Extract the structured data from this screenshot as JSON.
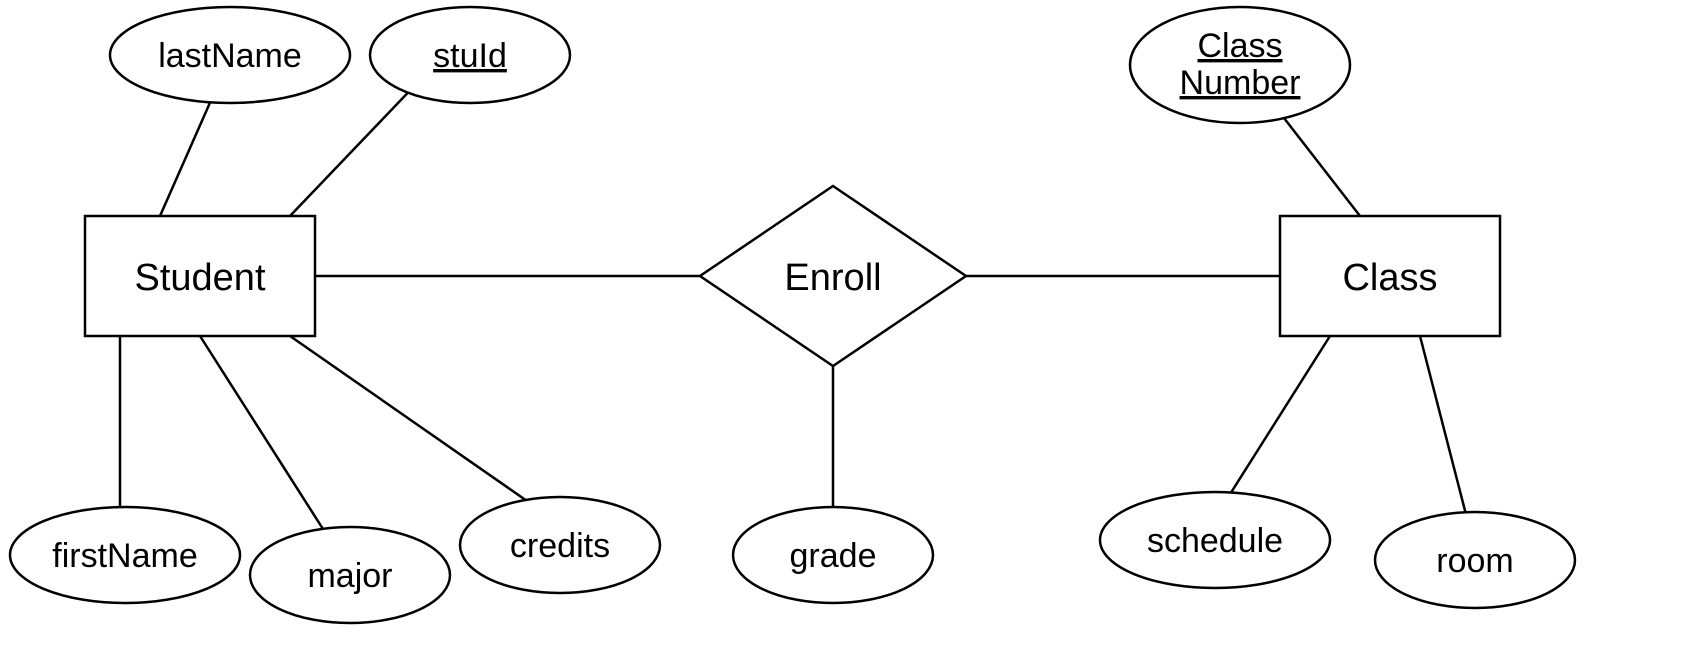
{
  "entities": {
    "student": {
      "label": "Student",
      "attributes": {
        "lastName": "lastName",
        "stuId": "stuId",
        "firstName": "firstName",
        "major": "major",
        "credits": "credits"
      }
    },
    "class": {
      "label": "Class",
      "attributes": {
        "classNumber_line1": "Class",
        "classNumber_line2": "Number",
        "schedule": "schedule",
        "room": "room"
      }
    }
  },
  "relationships": {
    "enroll": {
      "label": "Enroll",
      "attributes": {
        "grade": "grade"
      }
    }
  }
}
